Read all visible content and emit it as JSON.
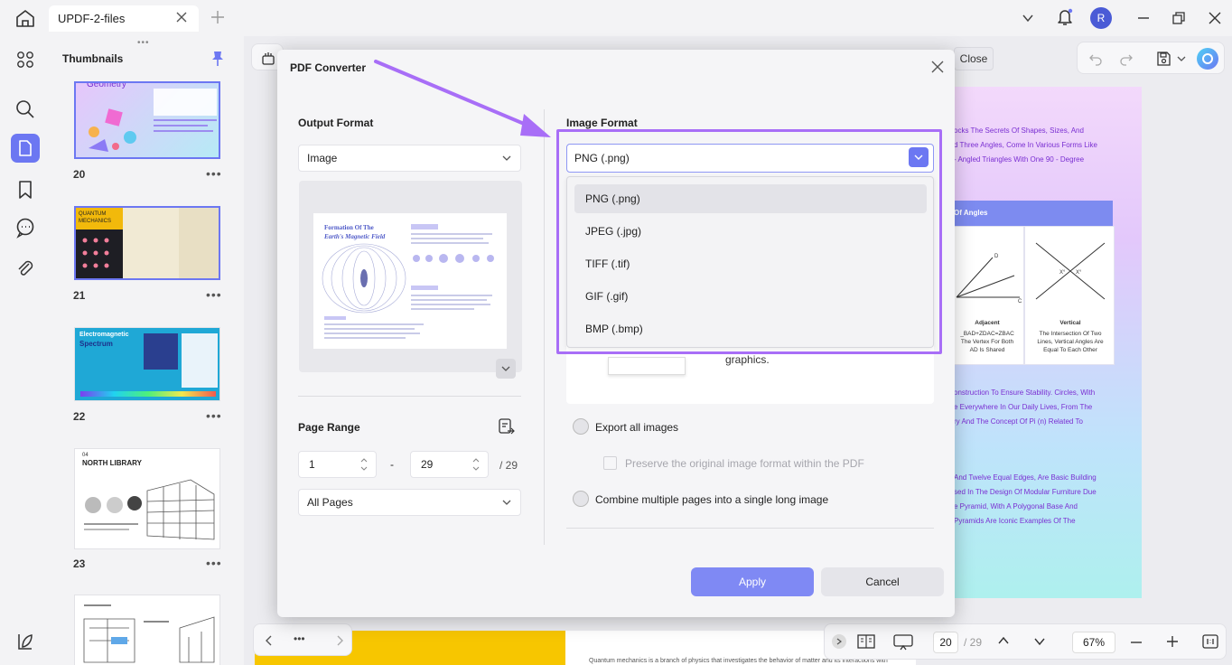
{
  "titlebar": {
    "tab_label": "UPDF-2-files",
    "avatar_initial": "R"
  },
  "thumbnails": {
    "title": "Thumbnails",
    "pages": [
      {
        "num": "20",
        "more": "•••"
      },
      {
        "num": "21",
        "more": "•••"
      },
      {
        "num": "22",
        "more": "•••"
      },
      {
        "num": "23",
        "more": "•••"
      }
    ],
    "thumb_texts": {
      "t20": "Geometry",
      "t21_a": "QUANTUM",
      "t21_b": "MECHANICS",
      "t22_a": "Electromagnetic",
      "t22_b": "Spectrum",
      "t23_a": "04",
      "t23_b": "NORTH LIBRARY"
    }
  },
  "document": {
    "close_label": "Close",
    "right_page_lines": [
      "ocks The Secrets Of Shapes, Sizes, And",
      "d Three Angles, Come In Various Forms Like",
      "- Angled Triangles With One 90 - Degree"
    ],
    "right_page_head": "Of Angles",
    "adjacent_title": "Adjacent",
    "adjacent_lines": [
      "_BAD+ZDAC=ZBAC",
      "The Vertex For Both",
      "AD Is Shared"
    ],
    "vertical_title": "Vertical",
    "vertical_lines": [
      "The Intersection Of Two",
      "Lines, Vertical Angles Are",
      "Equal To Each Other"
    ],
    "right_page_lines2": [
      "onstruction To Ensure Stability. Circles, With",
      "e Everywhere In Our Daily Lives, From The",
      "ry And The Concept Of Pi (n) Related To"
    ],
    "right_page_lines3": [
      "And Twelve Equal Edges, Are Basic Building",
      "sed In The Design Of Modular Furniture Due",
      "e Pyramid, With A Polygonal Base And",
      "Pyramids Are Iconic Examples Of The"
    ],
    "bottom_text": "Quantum mechanics is a branch of physics that investigates the behavior of matter and its interactions with"
  },
  "bottom_toolbar": {
    "page_current": "20",
    "page_total": "/ 29",
    "zoom": "67%",
    "more": "•••"
  },
  "modal": {
    "title": "PDF Converter",
    "output_format_label": "Output Format",
    "output_format_value": "Image",
    "preview_title_1": "Formation Of The",
    "preview_title_2": "Earth's Magnetic Field",
    "page_range_label": "Page Range",
    "range_from": "1",
    "range_sep": "-",
    "range_to": "29",
    "range_total": "/ 29",
    "pages_select": "All Pages",
    "image_format_label": "Image Format",
    "image_format_value": "PNG (.png)",
    "format_options": [
      "PNG (.png)",
      "JPEG (.jpg)",
      "TIFF (.tif)",
      "GIF (.gif)",
      "BMP (.bmp)"
    ],
    "under_text": "graphics.",
    "export_all_images": "Export all images",
    "preserve_format": "Preserve the original image format within the PDF",
    "combine_pages": "Combine multiple pages into a single long image",
    "apply_label": "Apply",
    "cancel_label": "Cancel"
  },
  "colors": {
    "accent": "#6c77f2",
    "highlight": "#a86ef7",
    "apply": "#7f89f4"
  }
}
